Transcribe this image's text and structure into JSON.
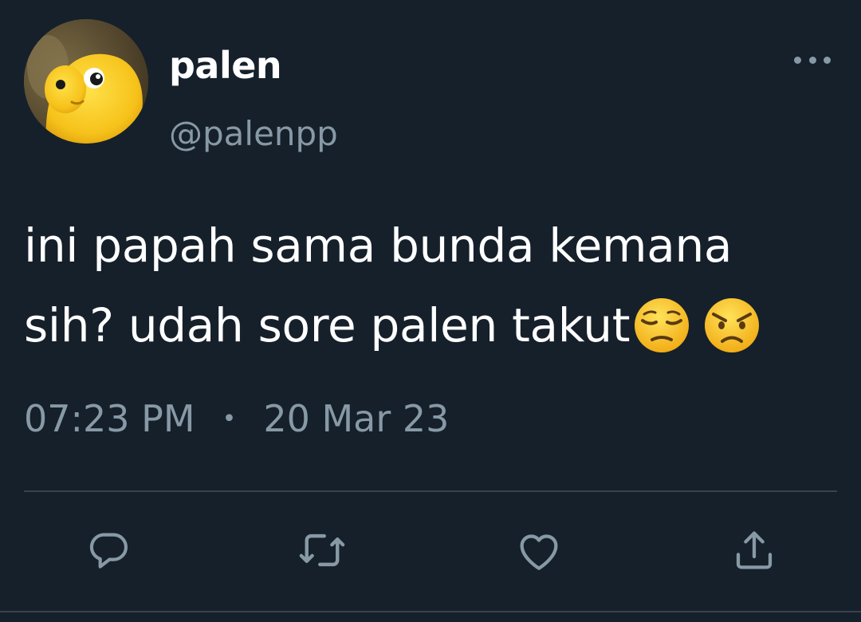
{
  "author": {
    "display_name": "palen",
    "handle": "@palenpp"
  },
  "tweet": {
    "text_line1": "ini papah sama bunda kemana",
    "text_line2": "sih? udah sore palen takut",
    "emojis": [
      "pensive-face",
      "angry-face"
    ]
  },
  "meta": {
    "time": "07:23 PM",
    "separator": "•",
    "date": "20 Mar 23"
  },
  "actions": [
    "reply-icon",
    "retweet-icon",
    "like-icon",
    "share-icon"
  ],
  "colors": {
    "background": "#15202b",
    "text_primary": "#ffffff",
    "text_secondary": "#8899a6",
    "divider": "#38444d"
  }
}
